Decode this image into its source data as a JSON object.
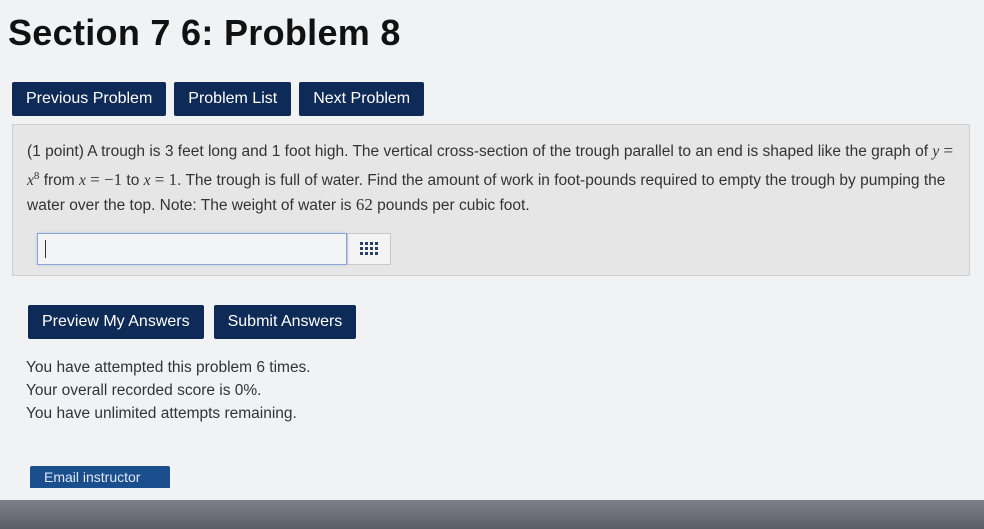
{
  "page": {
    "title": "Section 7 6: Problem 8"
  },
  "nav": {
    "previous_label": "Previous Problem",
    "list_label": "Problem List",
    "next_label": "Next Problem"
  },
  "problem": {
    "intro": "(1 point) A trough is 3 feet long and 1 foot high. The vertical cross-section of the trough parallel to an end is shaped like the graph of ",
    "eq_y": "y",
    "eq_equals1": " = ",
    "eq_x": "x",
    "eq_exp": "8",
    "from_text": " from ",
    "eq_x2": "x",
    "eq_equals2": " = −1",
    "to_text": " to ",
    "eq_x3": "x",
    "eq_equals3": " = 1",
    "rest": ". The trough is full of water. Find the amount of work in foot-pounds required to empty the trough by pumping the water over the top. Note: The weight of water is ",
    "weight": "62",
    "end": " pounds per cubic foot.",
    "answer_value": ""
  },
  "actions": {
    "preview_label": "Preview My Answers",
    "submit_label": "Submit Answers"
  },
  "status": {
    "attempts": "You have attempted this problem 6 times.",
    "score": "Your overall recorded score is 0%.",
    "remaining": "You have unlimited attempts remaining."
  },
  "footer": {
    "email_label": "Email instructor"
  },
  "icons": {
    "answer_tool": "grid-icon"
  }
}
